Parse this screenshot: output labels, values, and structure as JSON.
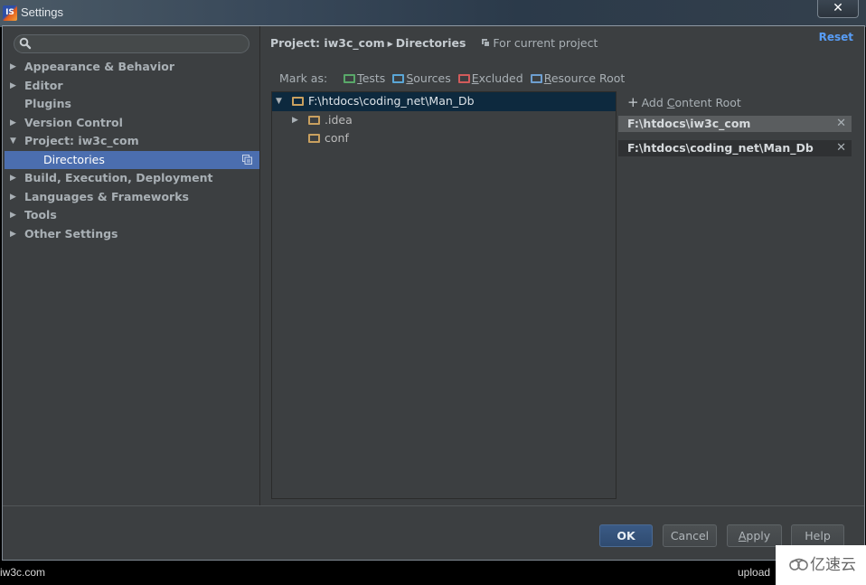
{
  "window": {
    "title": "Settings",
    "app_icon_text": "IS",
    "close_glyph": "✕"
  },
  "sidebar": {
    "search": {
      "value": "",
      "placeholder": ""
    },
    "items": [
      {
        "label": "Appearance & Behavior",
        "expandable": true,
        "expanded": false
      },
      {
        "label": "Editor",
        "expandable": true,
        "expanded": false
      },
      {
        "label": "Plugins",
        "expandable": false
      },
      {
        "label": "Version Control",
        "expandable": true,
        "expanded": false
      },
      {
        "label": "Project: iw3c_com",
        "expandable": true,
        "expanded": true
      },
      {
        "label": "Directories",
        "child": true,
        "selected": true
      },
      {
        "label": "Build, Execution, Deployment",
        "expandable": true,
        "expanded": false
      },
      {
        "label": "Languages & Frameworks",
        "expandable": true,
        "expanded": false
      },
      {
        "label": "Tools",
        "expandable": true,
        "expanded": false
      },
      {
        "label": "Other Settings",
        "expandable": true,
        "expanded": false
      }
    ],
    "arrow_collapsed": "▶",
    "arrow_expanded": "▼"
  },
  "content": {
    "breadcrumb": {
      "parent": "Project: iw3c_com",
      "separator": "▶",
      "current": "Directories"
    },
    "scope": "For current project",
    "reset_label": "Reset",
    "mark_as": {
      "label": "Mark as:",
      "buttons": [
        {
          "mnemonic": "T",
          "rest": "ests",
          "color": "#59a869"
        },
        {
          "mnemonic": "S",
          "rest": "ources",
          "color": "#5aa6d6"
        },
        {
          "mnemonic": "E",
          "rest": "xcluded",
          "color": "#d25b5b"
        },
        {
          "mnemonic": "R",
          "rest": "esource Root",
          "color": "#6e9fd0"
        }
      ]
    },
    "tree": [
      {
        "label": "F:\\htdocs\\coding_net\\Man_Db",
        "level": 0,
        "arrow": "▼",
        "selected": true
      },
      {
        "label": ".idea",
        "level": 1,
        "arrow": "▶",
        "selected": false
      },
      {
        "label": "conf",
        "level": 1,
        "arrow": "",
        "selected": false
      }
    ],
    "content_roots": {
      "add_label_prefix": "Add ",
      "add_label_mnemonic": "C",
      "add_label_rest": "ontent Root",
      "items": [
        {
          "path": "F:\\htdocs\\iw3c_com",
          "active": true
        },
        {
          "path": "F:\\htdocs\\coding_net\\Man_Db",
          "active": false
        }
      ],
      "remove_glyph": "✕"
    }
  },
  "footer": {
    "ok_label": "OK",
    "cancel_label": "Cancel",
    "apply_mnemonic": "A",
    "apply_rest": "pply",
    "help_label": "Help"
  },
  "taskbar": {
    "left_text": "iw3c.com",
    "right_text": "upload"
  },
  "watermark": {
    "text": "亿速云"
  },
  "colors": {
    "accent_selection": "#4b6eaf",
    "tree_selection": "#0d293e",
    "reset_link": "#589df6",
    "folder": "#c9a05f"
  }
}
